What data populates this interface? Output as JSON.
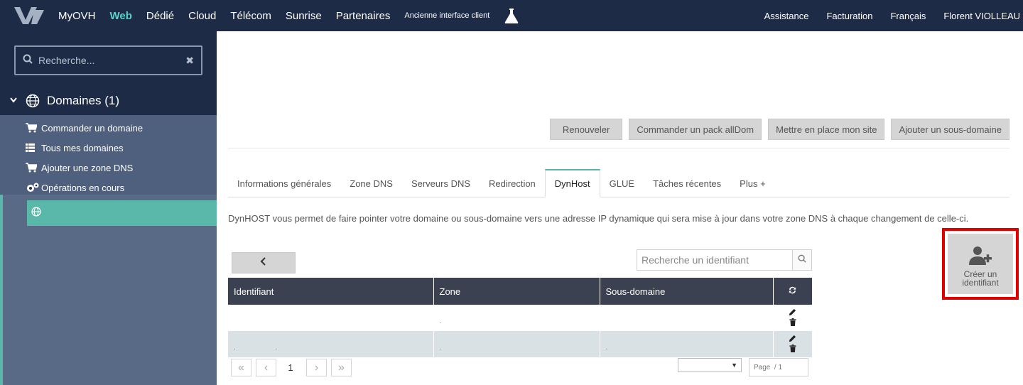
{
  "topbar": {
    "nav": [
      "MyOVH",
      "Web",
      "Dédié",
      "Cloud",
      "Télécom",
      "Sunrise",
      "Partenaires"
    ],
    "active": "Web",
    "old_interface": "Ancienne interface client",
    "right": {
      "assistance": "Assistance",
      "billing": "Facturation",
      "language": "Français",
      "user": "Florent VIOLLEAU"
    }
  },
  "sidebar": {
    "search_placeholder": "Recherche...",
    "domains_header": "Domaines (1)",
    "links": [
      {
        "label": "Commander un domaine",
        "icon": "cart-icon"
      },
      {
        "label": "Tous mes domaines",
        "icon": "list-icon"
      },
      {
        "label": "Ajouter une zone DNS",
        "icon": "cart-icon"
      },
      {
        "label": "Opérations en cours",
        "icon": "gears-icon"
      }
    ]
  },
  "actions": {
    "renew": "Renouveler",
    "alldom": "Commander un pack allDom",
    "setup_site": "Mettre en place mon site",
    "add_subdomain": "Ajouter un sous-domaine"
  },
  "tabs": [
    "Informations générales",
    "Zone DNS",
    "Serveurs DNS",
    "Redirection",
    "DynHost",
    "GLUE",
    "Tâches récentes",
    "Plus +"
  ],
  "active_tab": "DynHost",
  "description": "DynHOST vous permet de faire pointer votre domaine ou sous-domaine vers une adresse IP dynamique qui sera mise à jour dans votre zone DNS à chaque changement de celle-ci.",
  "id_search_placeholder": "Recherche un identifiant",
  "table": {
    "headers": {
      "id": "Identifiant",
      "zone": "Zone",
      "subdomain": "Sous-domaine"
    },
    "rows": [
      {
        "id": "",
        "zone": ".",
        "subdomain": ""
      },
      {
        "id": ".                    .",
        "zone": ".",
        "subdomain": "."
      }
    ]
  },
  "pager": {
    "current": "1",
    "page_label": "Page  / 1"
  },
  "create_button": {
    "label": "Créer un identifiant"
  },
  "colors": {
    "topbar": "#1d2b47",
    "accent": "#59b8a9",
    "active_nav": "#59d2c9",
    "highlight": "#e00000"
  }
}
